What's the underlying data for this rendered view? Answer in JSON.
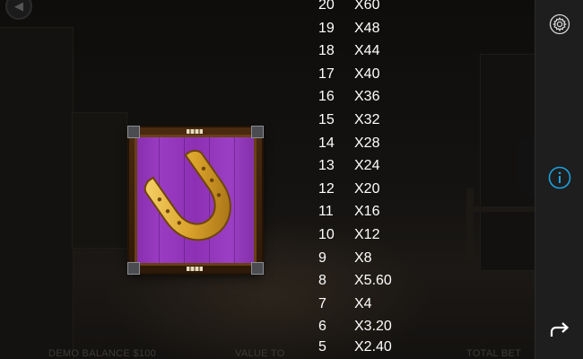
{
  "paytable": {
    "rows": [
      {
        "count": "20",
        "multiplier": "X60"
      },
      {
        "count": "19",
        "multiplier": "X48"
      },
      {
        "count": "18",
        "multiplier": "X44"
      },
      {
        "count": "17",
        "multiplier": "X40"
      },
      {
        "count": "16",
        "multiplier": "X36"
      },
      {
        "count": "15",
        "multiplier": "X32"
      },
      {
        "count": "14",
        "multiplier": "X28"
      },
      {
        "count": "13",
        "multiplier": "X24"
      },
      {
        "count": "12",
        "multiplier": "X20"
      },
      {
        "count": "11",
        "multiplier": "X16"
      },
      {
        "count": "10",
        "multiplier": "X12"
      },
      {
        "count": "9",
        "multiplier": "X8"
      },
      {
        "count": "8",
        "multiplier": "X5.60"
      },
      {
        "count": "7",
        "multiplier": "X4"
      },
      {
        "count": "6",
        "multiplier": "X3.20"
      },
      {
        "count": "5",
        "multiplier": "X2.40"
      }
    ]
  },
  "symbol": {
    "name": "horseshoe",
    "icon": "horseshoe-icon"
  },
  "bottom_bar": {
    "balance": "DEMO BALANCE $100",
    "bet": "VALUE TO",
    "win": "TOTAL BET"
  },
  "sidebar": {
    "settings_icon": "gear-icon",
    "info_icon": "info-icon",
    "return_icon": "return-arrow-icon"
  },
  "colors": {
    "symbol_background": "#9a3cc2",
    "horseshoe_gold": "#d9a22a",
    "info_accent": "#1aa3e0",
    "sidebar": "#1e1e1e"
  }
}
